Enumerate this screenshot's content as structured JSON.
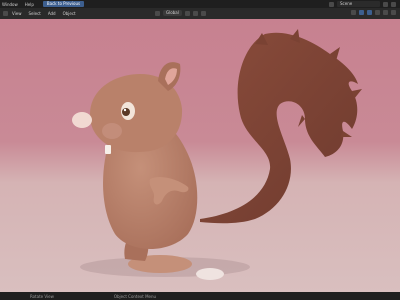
{
  "topbar": {
    "menus": [
      "Window",
      "Help"
    ],
    "back_button_label": "Back to Previous",
    "scene_label": "Scene"
  },
  "toolbar": {
    "menus": [
      "View",
      "Select",
      "Add",
      "Object"
    ],
    "orientation_label": "Global"
  },
  "statusbar": {
    "item1": "Rotate View",
    "item2": "Object Context Menu"
  },
  "colors": {
    "background_top": "#c98693",
    "floor": "#d6b5b6",
    "squirrel_body": "#b9816a",
    "tail": "#7a4233"
  }
}
